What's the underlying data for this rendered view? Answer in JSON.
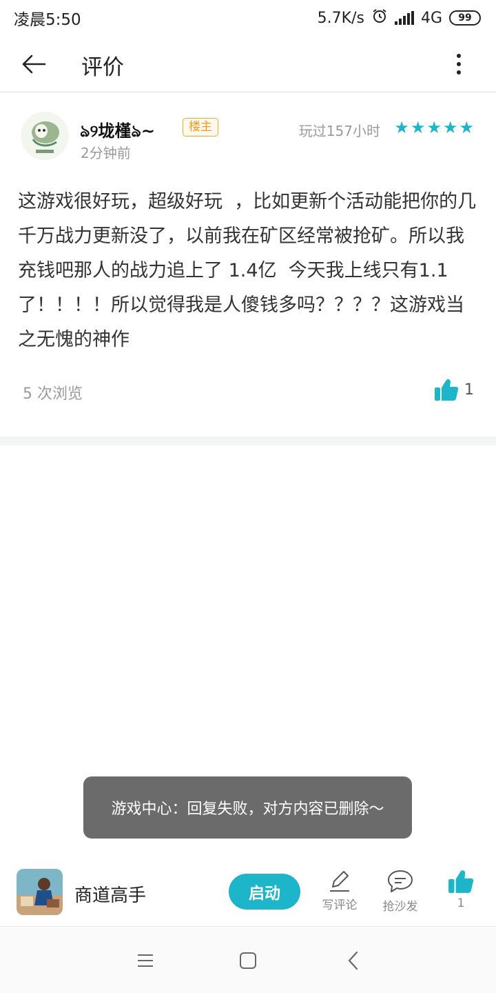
{
  "status_bar": {
    "time": "凌晨5:50",
    "network_speed": "5.7K/s",
    "network_type": "4G",
    "battery": "99",
    "icons": [
      "alarm-icon",
      "signal-icon",
      "battery-icon"
    ]
  },
  "app_bar": {
    "title": "评价",
    "back_icon": "arrow-left-icon",
    "more_icon": "more-vertical-icon"
  },
  "review": {
    "username": "ঌ୨垅槿ঌ~",
    "badge": "楼主",
    "posted_time": "2分钟前",
    "played_time": "玩过157小时",
    "rating": 5,
    "body": "这游戏很好玩，超级好玩  ，比如更新个活动能把你的几千万战力更新没了，以前我在矿区经常被抢矿。所以我充钱吧那人的战力追上了 1.4亿  今天我上线只有1.1了！！！！所以觉得我是人傻钱多吗？？？？这游戏当之无愧的神作",
    "views": "5 次浏览",
    "likes": "1"
  },
  "toast": {
    "message": "游戏中心：回复失败，对方内容已删除～"
  },
  "bottom_bar": {
    "game_name": "商道高手",
    "launch_label": "启动",
    "write_review_label": "写评论",
    "sofa_label": "抢沙发",
    "like_count": "1"
  },
  "nav_bar": {
    "icons": [
      "menu-icon",
      "home-square-icon",
      "back-chevron-icon"
    ]
  },
  "colors": {
    "accent": "#1cb5c9",
    "badge_orange": "#f29b1f",
    "toast_bg": "#6b6b6b",
    "secondary_text": "#9a9a9a"
  }
}
